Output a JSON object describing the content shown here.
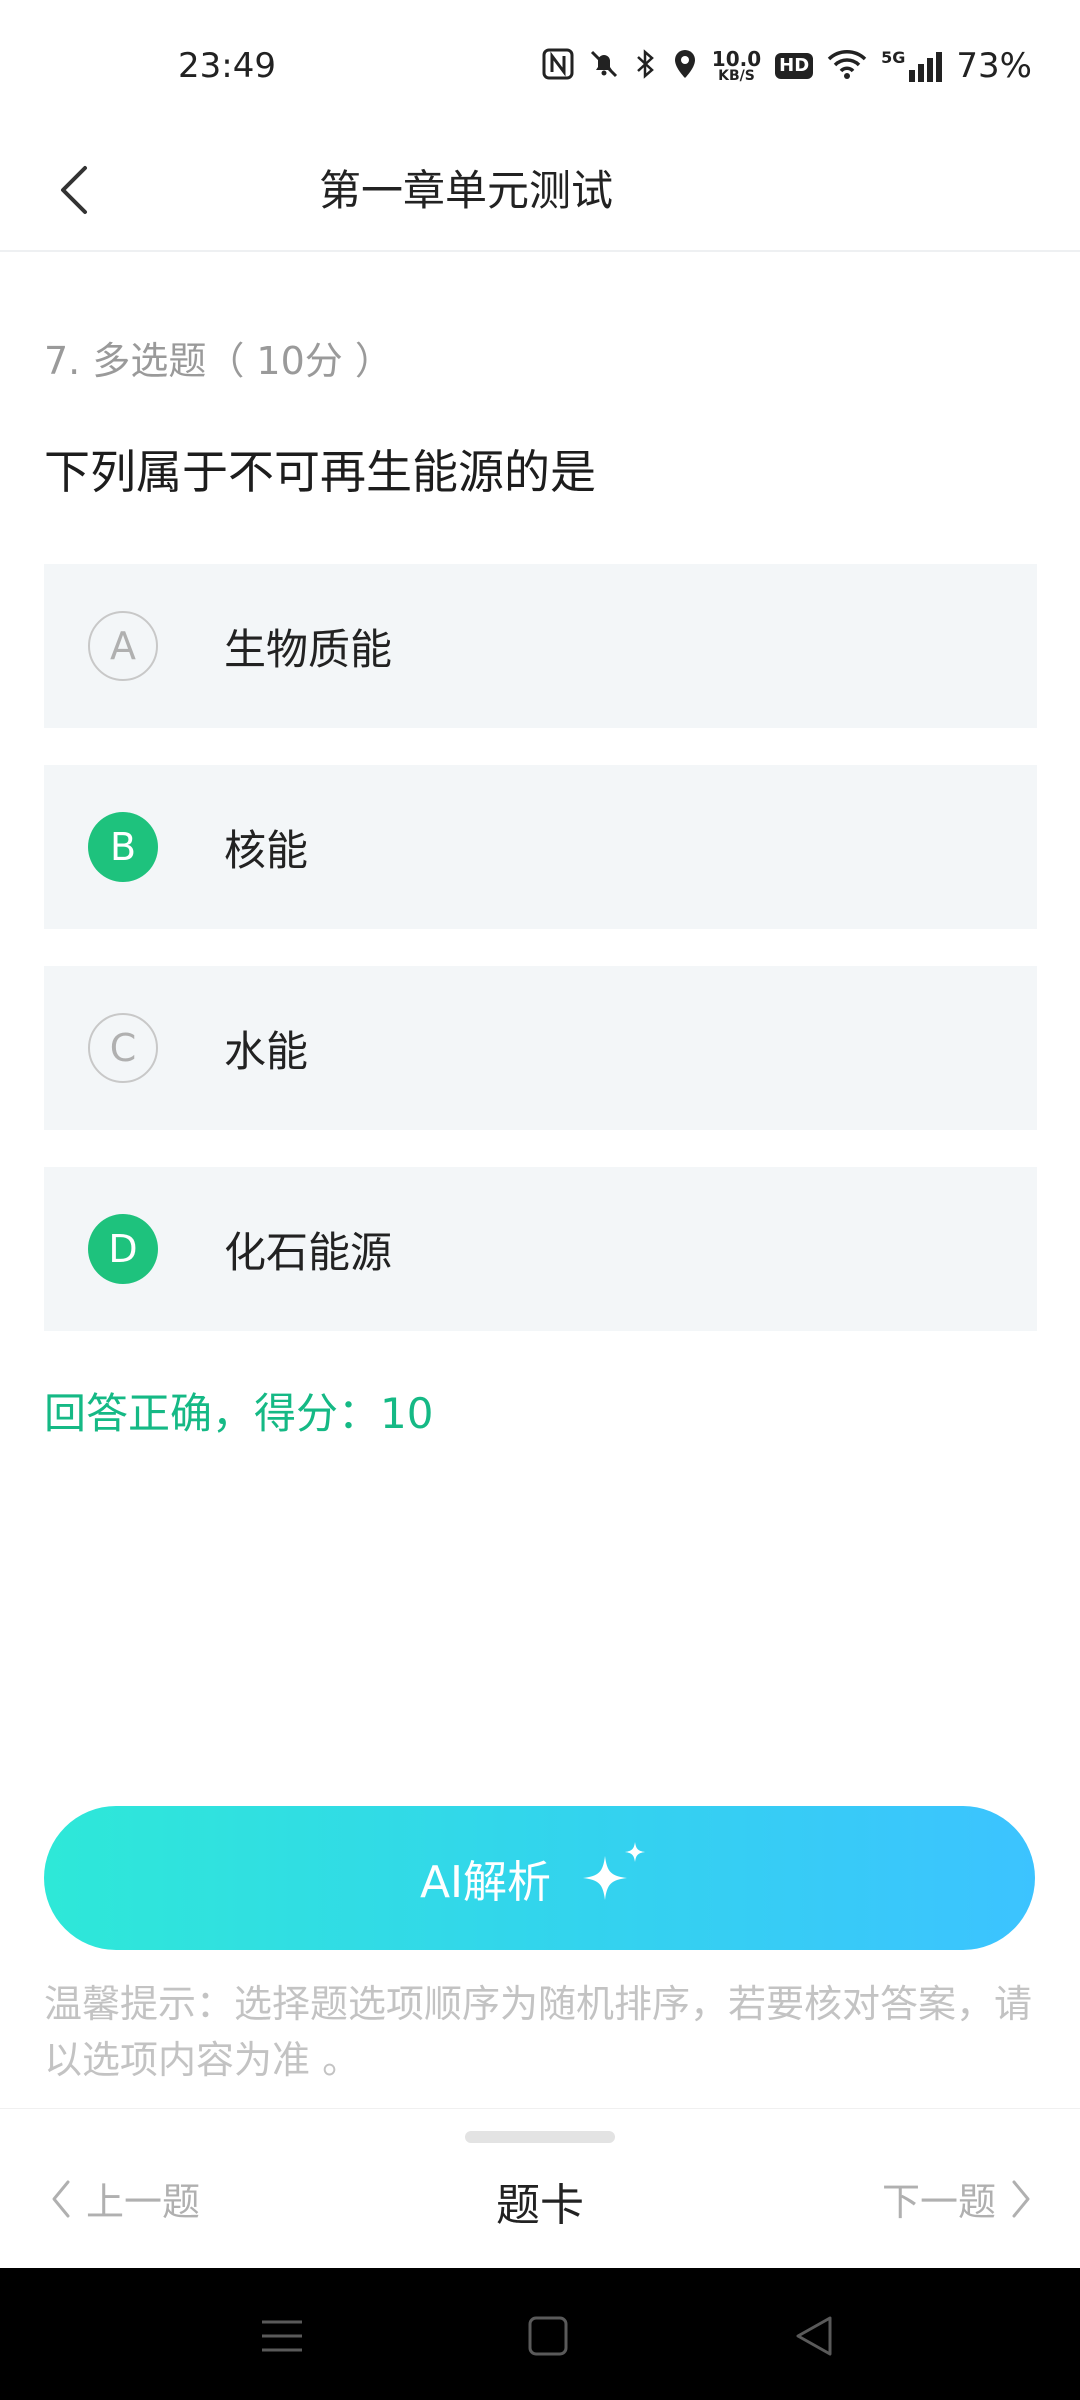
{
  "status_bar": {
    "time": "23:49",
    "net_speed_value": "10.0",
    "net_speed_unit": "KB/S",
    "hd": "HD",
    "signal": "5G",
    "battery": "73%",
    "icons": [
      "nfc-icon",
      "mute-icon",
      "bluetooth-icon",
      "location-icon",
      "wifi-icon",
      "signal-icon"
    ]
  },
  "header": {
    "title": "第一章单元测试",
    "back_icon": "chevron-left-icon"
  },
  "question": {
    "meta": "7. 多选题（ 10分 ）",
    "text": "下列属于不可再生能源的是",
    "options": [
      {
        "letter": "A",
        "label": "生物质能",
        "selected": false
      },
      {
        "letter": "B",
        "label": "核能",
        "selected": true
      },
      {
        "letter": "C",
        "label": "水能",
        "selected": false
      },
      {
        "letter": "D",
        "label": "化石能源",
        "selected": true
      }
    ],
    "result": "回答正确，得分：10"
  },
  "ai_button": {
    "label": "AI解析",
    "icon": "sparkle-icon"
  },
  "tip": "温馨提示：选择题选项顺序为随机排序，若要核对答案，请以选项内容为准 。",
  "bottom_nav": {
    "prev": "上一题",
    "card": "题卡",
    "next": "下一题"
  },
  "colors": {
    "accent_green": "#1ec27d",
    "result_green": "#15b985",
    "option_bg": "#f3f6f8",
    "ai_gradient_start": "#2ee8d8",
    "ai_gradient_end": "#3cc3ff"
  }
}
